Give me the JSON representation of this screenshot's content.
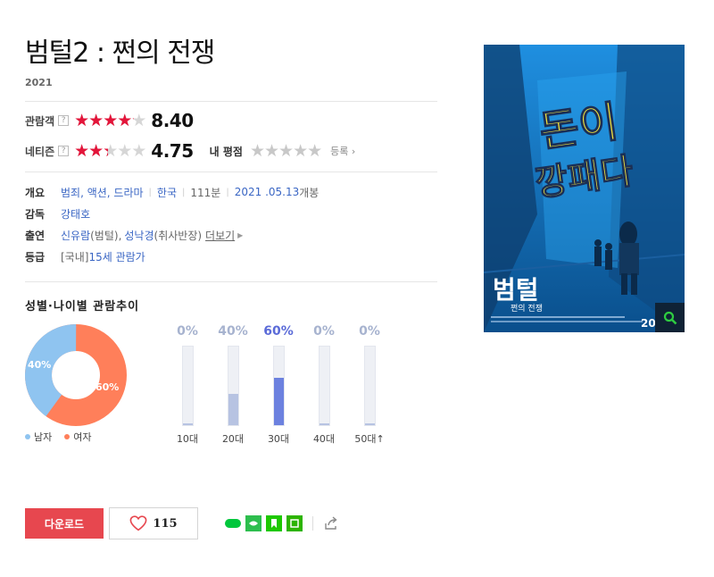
{
  "movie": {
    "title": "범털2 : 쩐의 전쟁",
    "year": "2021"
  },
  "ratings": {
    "audience": {
      "label": "관람객",
      "help": "?",
      "score": "8.40",
      "fill_pct": 84
    },
    "netizen": {
      "label": "네티즌",
      "help": "?",
      "score": "4.75",
      "fill_pct": 47.5
    },
    "my_rating": {
      "label": "내 평점",
      "register": "등록"
    }
  },
  "info": {
    "overview": {
      "label": "개요",
      "genre": "범죄, 액션, 드라마",
      "country": "한국",
      "runtime": "111분",
      "release_date": "2021 .05.13",
      "release_suffix": "개봉"
    },
    "director": {
      "label": "감독",
      "name": "강태호"
    },
    "cast": {
      "label": "출연",
      "actor1": "신유람",
      "role1": "(범털), ",
      "actor2": "성낙경",
      "role2": "(취사반장) ",
      "more": "더보기"
    },
    "grade": {
      "label": "등급",
      "prefix": "[국내] ",
      "rating": "15세 관람가"
    }
  },
  "trend": {
    "title": "성별·나이별 관람추이",
    "gender": {
      "male_pct": 40,
      "male_label": "40%",
      "male_legend": "남자",
      "female_pct": 60,
      "female_label": "60%",
      "female_legend": "여자",
      "male_color": "#8fc4f0",
      "female_color": "#ff7f5a"
    },
    "ages": [
      {
        "label": "10대",
        "pct_label": "0%",
        "pct": 0
      },
      {
        "label": "20대",
        "pct_label": "40%",
        "pct": 40
      },
      {
        "label": "30대",
        "pct_label": "60%",
        "pct": 60
      },
      {
        "label": "40대",
        "pct_label": "0%",
        "pct": 0
      },
      {
        "label": "50대↑",
        "pct_label": "0%",
        "pct": 0
      }
    ]
  },
  "actions": {
    "download": "다운로드",
    "like_count": "115"
  },
  "poster": {
    "headline_line1": "돈이",
    "headline_line2": "깡패다",
    "logo": "범털",
    "logo_sub": "쩐의 전쟁",
    "credit_number": "20"
  },
  "colors": {
    "accent_red": "#e7474f",
    "star_red": "#e3153a",
    "link_blue": "#3a66c4",
    "age_highlight": "#5b6bd8"
  }
}
